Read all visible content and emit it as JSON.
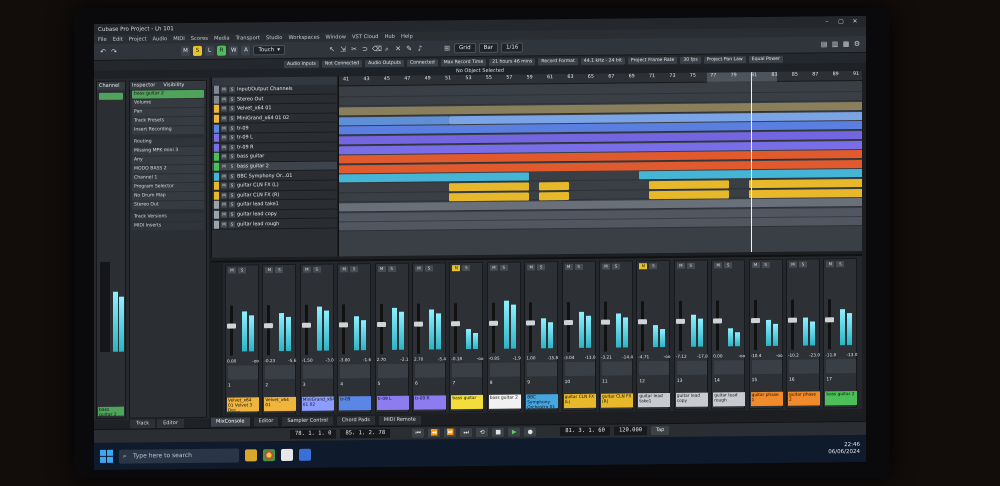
{
  "window": {
    "title": "Cubase Pro Project - Lh 101"
  },
  "menu": [
    "File",
    "Edit",
    "Project",
    "Audio",
    "MIDI",
    "Scores",
    "Media",
    "Transport",
    "Studio",
    "Workspaces",
    "Window",
    "VST Cloud",
    "Hub",
    "Help"
  ],
  "toolbar": {
    "buttons": [
      "M",
      "S",
      "L",
      "R",
      "W",
      "A"
    ],
    "automation_mode": "Touch",
    "snap_type": "Grid",
    "grid_value": "Bar",
    "quantize": "1/16"
  },
  "info_line": [
    "Audio Inputs",
    "Not Connected",
    "Audio Outputs",
    "Connected",
    "Max Record Time",
    "21 hours 46 mins",
    "Record Format",
    "44.1 kHz - 24 bit",
    "Project Frame Rate",
    "30 fps",
    "Project Pan Law",
    "Equal Power"
  ],
  "status": "No Object Selected",
  "channel_panel": {
    "title": "Channel",
    "name_chip": "bass guitar 2"
  },
  "inspector": {
    "tabs": [
      "Inspector",
      "Visibility"
    ],
    "track_name": "bass guitar 2",
    "rows": [
      "Volume",
      "Pan",
      "Track Presets",
      "Insert Recording",
      "Routing",
      "Missing MPK mini 3",
      "Any",
      "MODO BASS 2",
      "Channel 1",
      "Program Selector",
      "No Drum Map",
      "Stereo Out",
      "Track Versions",
      "MIDI Inserts"
    ],
    "volume_value": "-6.31 dB",
    "pan_value": "C"
  },
  "tracks": [
    {
      "name": "Input/Output Channels",
      "color": "#7f8a95"
    },
    {
      "name": "Stereo Out",
      "color": "#7f8a95"
    },
    {
      "name": "Velvet_x64 01",
      "color": "#f0b53c"
    },
    {
      "name": "MiniGrand_x64 01 02",
      "color": "#f0b53c"
    },
    {
      "name": "tr-09",
      "color": "#5a86e6"
    },
    {
      "name": "tr-09 L",
      "color": "#7a6ee8"
    },
    {
      "name": "tr-09 R",
      "color": "#7a6ee8"
    },
    {
      "name": "bass guitar",
      "color": "#4cbf59"
    },
    {
      "name": "bass guitar 2",
      "color": "#4cbf59"
    },
    {
      "name": "BBC Symphony Or...01",
      "color": "#45b5d6"
    },
    {
      "name": "guitar CLN FX (L)",
      "color": "#e6b82a"
    },
    {
      "name": "guitar CLN FX (R)",
      "color": "#e6b82a"
    },
    {
      "name": "guitar lead take1",
      "color": "#9aa2ab"
    },
    {
      "name": "guitar lead copy",
      "color": "#9aa2ab"
    },
    {
      "name": "guitar lead rough",
      "color": "#9aa2ab"
    }
  ],
  "ruler": [
    "41",
    "43",
    "45",
    "47",
    "49",
    "51",
    "53",
    "55",
    "57",
    "59",
    "61",
    "63",
    "65",
    "67",
    "69",
    "71",
    "73",
    "75",
    "77",
    "79",
    "81",
    "83",
    "85",
    "87",
    "89",
    "91"
  ],
  "locator_range": "21/29",
  "mixer": {
    "channels": [
      {
        "name": "Velvet_x64 01 Velvet 3 Dec...",
        "color": "#f0b53c",
        "vals": [
          "0.00",
          "-oo"
        ],
        "num": "1",
        "ms": "M"
      },
      {
        "name": "Velvet_x64 01",
        "color": "#f0b53c",
        "vals": [
          "-0.23",
          "-5.6"
        ],
        "num": "2",
        "ms": "M"
      },
      {
        "name": "MiniGrand_x64 01 02",
        "color": "#8c9cff",
        "vals": [
          "-1.50",
          "-3.0"
        ],
        "num": "3",
        "ms": "M"
      },
      {
        "name": "tr-09",
        "color": "#5a86e6",
        "vals": [
          "-3.80",
          "-1.6"
        ],
        "num": "4",
        "ms": "M"
      },
      {
        "name": "tr-09 L",
        "color": "#8c7cf0",
        "vals": [
          "2.70",
          "-2.1"
        ],
        "num": "5",
        "ms": "M"
      },
      {
        "name": "tr-09 R",
        "color": "#8c7cf0",
        "vals": [
          "2.70",
          "-5.4"
        ],
        "num": "6",
        "ms": "M"
      },
      {
        "name": "bass guitar",
        "color": "#f2dd3a",
        "vals": [
          "-0.18",
          "-oo"
        ],
        "num": "7",
        "ms": "M"
      },
      {
        "name": "bass guitar 2",
        "color": "#f1f1f1",
        "vals": [
          "-0.85",
          "-1.9"
        ],
        "num": "8",
        "ms": "M"
      },
      {
        "name": "BBC Symphony Orchestra 01",
        "color": "#45a6e0",
        "vals": [
          "1.00",
          "-15.8"
        ],
        "num": "9",
        "ms": "M"
      },
      {
        "name": "guitar CLN FX (L)",
        "color": "#e6b82a",
        "vals": [
          "-3.04",
          "-13.0"
        ],
        "num": "10",
        "ms": "M"
      },
      {
        "name": "guitar CLN FX (R)",
        "color": "#e6b82a",
        "vals": [
          "-3.21",
          "-14.4"
        ],
        "num": "11",
        "ms": "M"
      },
      {
        "name": "guitar lead take1",
        "color": "#c8ccd0",
        "vals": [
          "-4.71",
          "-oo"
        ],
        "num": "12",
        "ms": "M"
      },
      {
        "name": "guitar lead copy",
        "color": "#c8ccd0",
        "vals": [
          "-7.12",
          "-17.8"
        ],
        "num": "13",
        "ms": "M"
      },
      {
        "name": "guitar lead rough",
        "color": "#c8ccd0",
        "vals": [
          "0.00",
          "-oo"
        ],
        "num": "14",
        "ms": "M"
      },
      {
        "name": "guitar phase 1",
        "color": "#f08a2a",
        "vals": [
          "-10.4",
          "-oo"
        ],
        "num": "15",
        "ms": "M"
      },
      {
        "name": "guitar phase 2",
        "color": "#f08a2a",
        "vals": [
          "-10.2",
          "-23.0"
        ],
        "num": "16",
        "ms": "M"
      },
      {
        "name": "bass guitar 2",
        "color": "#4cbf59",
        "vals": [
          "-11.8",
          "-13.0"
        ],
        "num": "17",
        "ms": "M"
      }
    ]
  },
  "lower_tabs": [
    "MixConsole",
    "Editor",
    "Sampler Control",
    "Chord Pads",
    "MIDI Remote"
  ],
  "left_tabs": [
    "Track",
    "Editor"
  ],
  "transport": {
    "left_locator": "78. 1. 1. 0",
    "right_locator": "85. 1. 2. 78",
    "position": "81. 3. 1. 60",
    "tempo": "120.000",
    "tap": "Tap"
  },
  "taskbar": {
    "search_placeholder": "Type here to search",
    "time": "22:46",
    "date": "06/06/2024"
  }
}
